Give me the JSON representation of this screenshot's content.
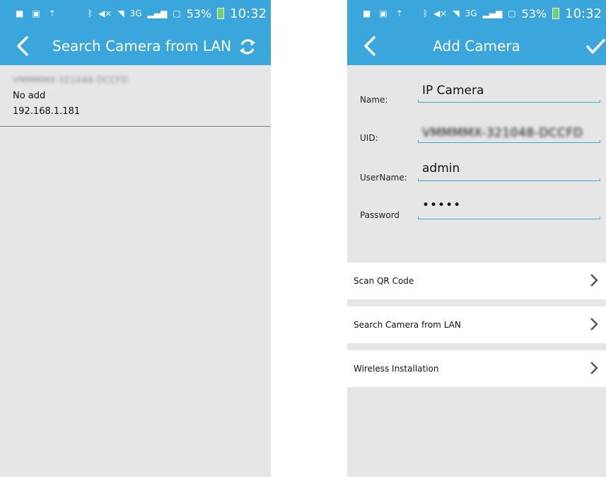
{
  "status_bar": {
    "battery": "53%",
    "time": "10:32",
    "network": "3G"
  },
  "left": {
    "title": "Search Camera from LAN",
    "device": {
      "uid": "VMMMMX-321048-DCCFD",
      "status": "No add",
      "ip": "192.168.1.181"
    }
  },
  "right": {
    "title": "Add Camera",
    "fields": {
      "name_label": "Name:",
      "name_value": "IP Camera",
      "uid_label": "UID:",
      "uid_value": "VMMMMX-321048-DCCFD",
      "username_label": "UserName:",
      "username_value": "admin",
      "password_label": "Password",
      "password_value": "•••••"
    },
    "menu": [
      {
        "label": "Scan QR Code"
      },
      {
        "label": "Search Camera from LAN"
      },
      {
        "label": "Wireless Installation"
      }
    ]
  },
  "colors": {
    "accent": "#3aa6dc",
    "background": "#e6e6e6",
    "battery": "#6fd26f"
  }
}
